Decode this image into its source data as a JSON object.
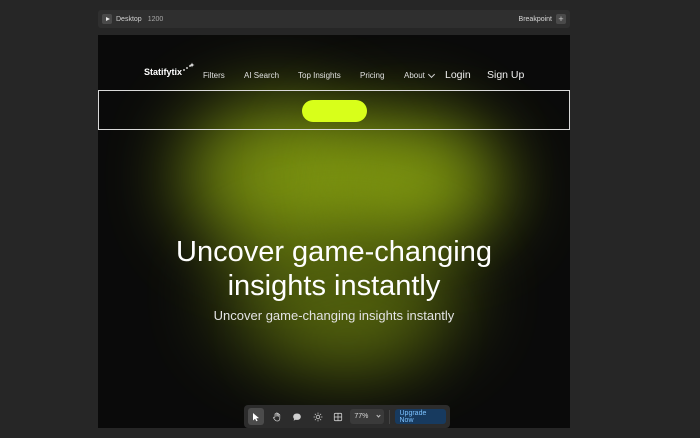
{
  "editor": {
    "device": "Desktop",
    "width": "1200",
    "breakpoint_label": "Breakpoint"
  },
  "nav": {
    "logo": "Statifytix",
    "links": [
      "Filters",
      "AI Search",
      "Top Insights",
      "Pricing",
      "About"
    ],
    "login": "Login",
    "signup": "Sign Up"
  },
  "hero": {
    "title_line1": "Uncover game-changing",
    "title_line2": "insights instantly",
    "subtitle": "Uncover game-changing insights instantly"
  },
  "toolbar": {
    "zoom": "77%",
    "upgrade": "Upgrade Now"
  },
  "colors": {
    "accent": "#d8ff1a",
    "glow": "#b4d713",
    "canvas": "#0a0a0a"
  }
}
